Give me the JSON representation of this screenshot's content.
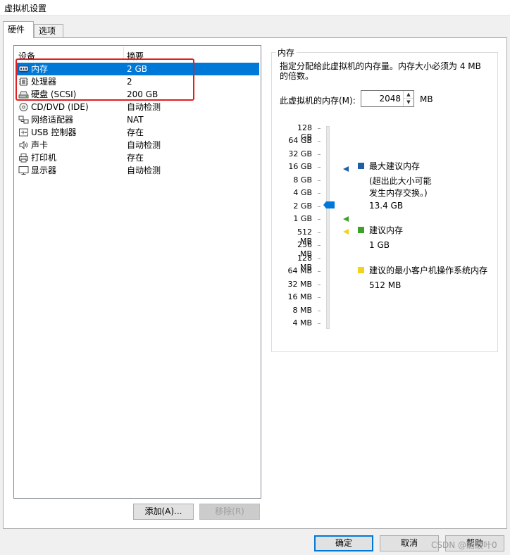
{
  "window": {
    "title": "虚拟机设置"
  },
  "tabs": [
    {
      "label": "硬件"
    },
    {
      "label": "选项"
    }
  ],
  "device_list": {
    "col_device": "设备",
    "col_summary": "摘要",
    "rows": [
      {
        "name": "内存",
        "summary": "2 GB",
        "icon": "memory-icon"
      },
      {
        "name": "处理器",
        "summary": "2",
        "icon": "cpu-icon"
      },
      {
        "name": "硬盘 (SCSI)",
        "summary": "200 GB",
        "icon": "harddisk-icon"
      },
      {
        "name": "CD/DVD (IDE)",
        "summary": "自动检测",
        "icon": "cd-dvd-icon"
      },
      {
        "name": "网络适配器",
        "summary": "NAT",
        "icon": "network-adapter-icon"
      },
      {
        "name": "USB 控制器",
        "summary": "存在",
        "icon": "usb-icon"
      },
      {
        "name": "声卡",
        "summary": "自动检测",
        "icon": "sound-card-icon"
      },
      {
        "name": "打印机",
        "summary": "存在",
        "icon": "printer-icon"
      },
      {
        "name": "显示器",
        "summary": "自动检测",
        "icon": "monitor-icon"
      }
    ],
    "selected_index": 0
  },
  "buttons": {
    "add": "添加(A)...",
    "remove": "移除(R)",
    "ok": "确定",
    "cancel": "取消",
    "help": "帮助"
  },
  "memory": {
    "group_title": "内存",
    "description": "指定分配给此虚拟机的内存量。内存大小必须为 4 MB 的倍数。",
    "field_label": "此虚拟机的内存(M):",
    "value": "2048",
    "unit": "MB",
    "scale": [
      "128 GB",
      "64 GB",
      "32 GB",
      "16 GB",
      "8 GB",
      "4 GB",
      "2 GB",
      "1 GB",
      "512 MB",
      "256 MB",
      "128 MB",
      "64 MB",
      "32 MB",
      "16 MB",
      "8 MB",
      "4 MB"
    ],
    "slider_value": "2 GB",
    "max_recommended": {
      "title": "最大建议内存",
      "note": "(超出此大小可能\n发生内存交换。)",
      "value": "13.4 GB",
      "color": "#1f5fa8"
    },
    "recommended": {
      "title": "建议内存",
      "value": "1 GB",
      "color": "#3fa02a"
    },
    "min_guest": {
      "title": "建议的最小客户机操作系统内存",
      "value": "512 MB",
      "color": "#f2d21b"
    }
  },
  "watermark": "CSDN @醋酸叶0",
  "colors": {
    "selection": "#0078d7",
    "annotation_box": "#e02020"
  }
}
